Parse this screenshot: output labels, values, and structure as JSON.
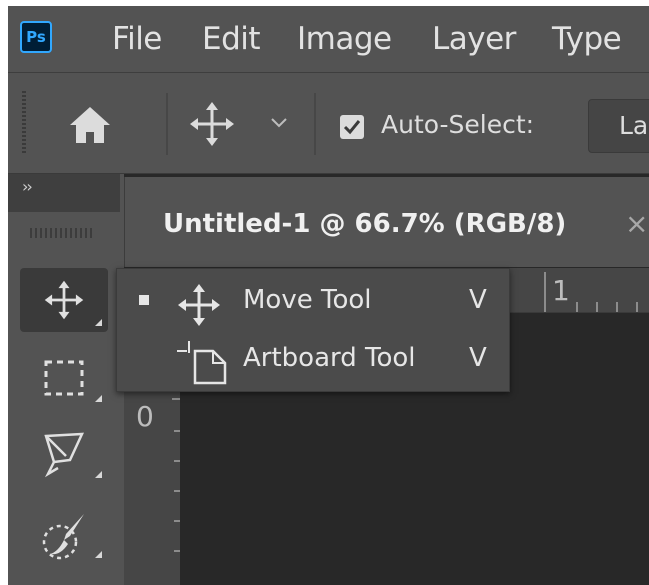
{
  "menubar": {
    "logo": "Ps",
    "items": [
      "File",
      "Edit",
      "Image",
      "Layer",
      "Type"
    ]
  },
  "options": {
    "home_icon": "home-icon",
    "tool_icon": "move-icon",
    "auto_select_label": "Auto-Select:",
    "auto_select_checked": true,
    "layer_select_value": "Lay"
  },
  "toolbar": {
    "collapse": "››",
    "tools": [
      {
        "name": "move-tool",
        "icon": "move-icon",
        "active": true
      },
      {
        "name": "marquee-tool",
        "icon": "marquee-icon",
        "active": false
      },
      {
        "name": "lasso-tool",
        "icon": "lasso-icon",
        "active": false
      },
      {
        "name": "quick-selection-tool",
        "icon": "quick-selection-icon",
        "active": false
      }
    ]
  },
  "document": {
    "tab_title": "Untitled-1 @ 66.7% (RGB/8)",
    "tab_close": "×",
    "ruler_top_label": "1",
    "ruler_left_label": "0"
  },
  "flyout": {
    "items": [
      {
        "label": "Move Tool",
        "shortcut": "V",
        "selected": true,
        "icon": "move-icon"
      },
      {
        "label": "Artboard Tool",
        "shortcut": "V",
        "selected": false,
        "icon": "artboard-icon"
      }
    ]
  },
  "colors": {
    "panel": "#535353",
    "canvas": "#282828",
    "ps_blue": "#31a8ff",
    "ps_navy": "#001e36"
  }
}
